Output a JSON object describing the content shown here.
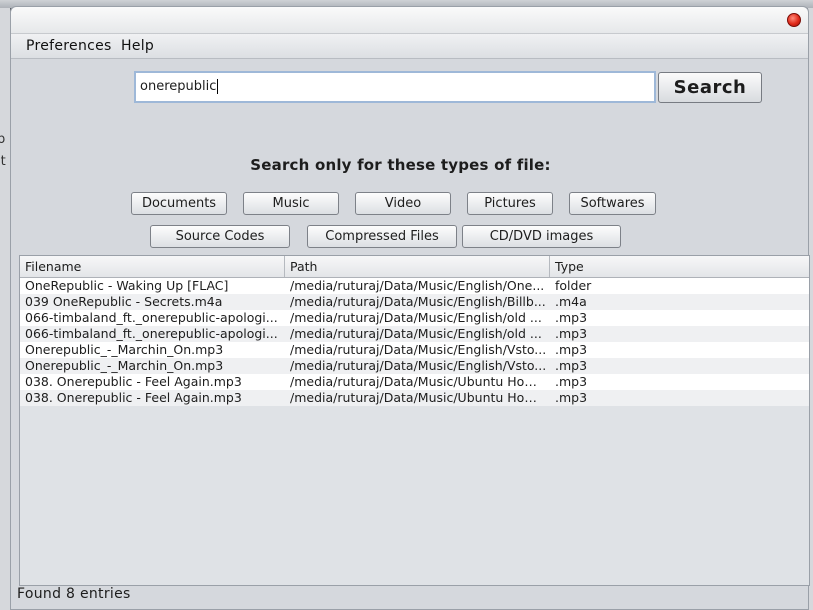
{
  "menu": [
    "Preferences",
    "Help"
  ],
  "search": {
    "query": "onerepublic",
    "button_label": "Search"
  },
  "filter": {
    "heading": "Search only for these types of file:",
    "row1": [
      "Documents",
      "Music",
      "Video",
      "Pictures",
      "Softwares"
    ],
    "row2": [
      "Source Codes",
      "Compressed Files",
      "CD/DVD images"
    ]
  },
  "table": {
    "columns": [
      "Filename",
      "Path",
      "Type"
    ],
    "rows": [
      [
        "OneRepublic - Waking Up [FLAC]",
        "/media/ruturaj/Data/Music/English/One...",
        "folder"
      ],
      [
        "039 OneRepublic - Secrets.m4a",
        "/media/ruturaj/Data/Music/English/Billb...",
        ".m4a"
      ],
      [
        "066-timbaland_ft._onerepublic-apologi...",
        "/media/ruturaj/Data/Music/English/old ...",
        ".mp3"
      ],
      [
        "066-timbaland_ft._onerepublic-apologi...",
        "/media/ruturaj/Data/Music/English/old ...",
        ".mp3"
      ],
      [
        "Onerepublic_-_Marchin_On.mp3",
        "/media/ruturaj/Data/Music/English/Vsto...",
        ".mp3"
      ],
      [
        "Onerepublic_-_Marchin_On.mp3",
        "/media/ruturaj/Data/Music/English/Vsto...",
        ".mp3"
      ],
      [
        "038. Onerepublic - Feel Again.mp3",
        "/media/ruturaj/Data/Music/Ubuntu Hom...",
        ".mp3"
      ],
      [
        "038. Onerepublic - Feel Again.mp3",
        "/media/ruturaj/Data/Music/Ubuntu Hom...",
        ".mp3"
      ]
    ]
  },
  "status": "Found 8 entries",
  "background_fragments": [
    "p",
    "lt"
  ],
  "colors": {
    "close_button": "#e02a1a",
    "input_focus_border": "#9eb8d8"
  }
}
